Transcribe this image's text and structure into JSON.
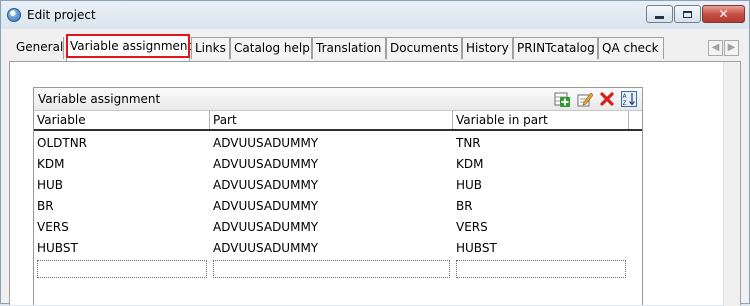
{
  "window": {
    "title": "Edit project"
  },
  "tabs": [
    {
      "label": "General"
    },
    {
      "label": "Variable assignment"
    },
    {
      "label": "Links"
    },
    {
      "label": "Catalog help"
    },
    {
      "label": "Translation"
    },
    {
      "label": "Documents"
    },
    {
      "label": "History"
    },
    {
      "label": "PRINTcatalog"
    },
    {
      "label": "QA check"
    }
  ],
  "active_tab": "Variable assignment",
  "panel": {
    "title": "Variable assignment",
    "tools": [
      "add-row-icon",
      "edit-icon",
      "delete-icon",
      "sort-icon"
    ],
    "columns": [
      "Variable",
      "Part",
      "Variable in part"
    ],
    "rows": [
      [
        "OLDTNR",
        "ADVUUSADUMMY",
        "TNR"
      ],
      [
        "KDM",
        "ADVUUSADUMMY",
        "KDM"
      ],
      [
        "HUB",
        "ADVUUSADUMMY",
        "HUB"
      ],
      [
        "BR",
        "ADVUUSADUMMY",
        "BR"
      ],
      [
        "VERS",
        "ADVUUSADUMMY",
        "VERS"
      ],
      [
        "HUBST",
        "ADVUUSADUMMY",
        "HUBST"
      ]
    ]
  },
  "colors": {
    "highlight": "#e4141a",
    "close_button": "#c75146"
  }
}
